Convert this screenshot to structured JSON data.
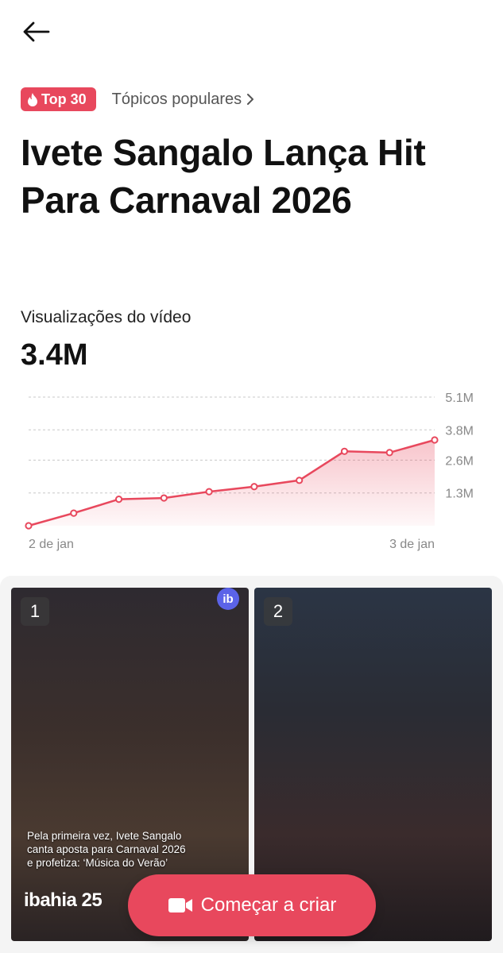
{
  "header": {
    "back_icon": "arrow-left-icon"
  },
  "badge": {
    "label": "Top 30",
    "icon": "fire-icon",
    "color": "#e8485d"
  },
  "topic_link": {
    "label": "Tópicos populares",
    "icon": "chevron-right-icon"
  },
  "title": "Ivete Sangalo Lança Hit Para Carnaval 2026",
  "metric": {
    "label": "Visualizações do vídeo",
    "value": "3.4M"
  },
  "chart_data": {
    "type": "area",
    "title": "",
    "xlabel": "",
    "ylabel": "",
    "x_start_label": "2 de jan",
    "x_end_label": "3 de jan",
    "y_tick_labels": [
      "1.3M",
      "2.6M",
      "3.8M",
      "5.1M"
    ],
    "y_ticks": [
      1.3,
      2.6,
      3.8,
      5.1
    ],
    "ylim": [
      0,
      5.1
    ],
    "unit": "M",
    "values": [
      0.0,
      0.5,
      1.05,
      1.1,
      1.35,
      1.55,
      1.8,
      2.95,
      2.9,
      3.4
    ],
    "grid": true,
    "color": "#e8485d"
  },
  "videos": [
    {
      "rank": "1",
      "source_badge": "ib",
      "caption": "Pela primeira vez, Ivete Sangalo canta aposta para Carnaval 2026 e profetiza: ‘Música do Verão’",
      "watermark": "ibahia 25"
    },
    {
      "rank": "2"
    }
  ],
  "cta": {
    "label": "Começar a criar",
    "icon": "video-camera-icon"
  }
}
